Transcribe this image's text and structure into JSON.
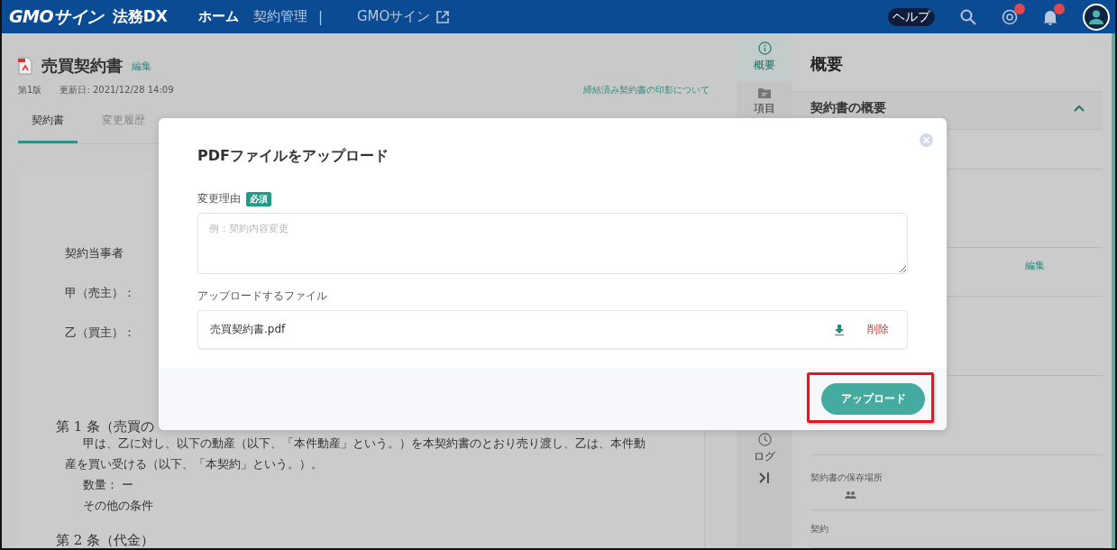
{
  "nav": {
    "logo": "GMOサイン",
    "product": "法務DX",
    "links": [
      {
        "label": "ホーム",
        "selected": true
      },
      {
        "label": "契約管理",
        "selected": false
      }
    ],
    "separator": "|",
    "external": "GMOサイン",
    "help": "ヘルプ",
    "mentions_badge": true,
    "notifications_badge": true
  },
  "document": {
    "title": "売買契約書",
    "edit": "編集",
    "version": "第1版",
    "updated": "更新日: 2021/12/28 14:09",
    "seal_link": "締結済み契約書の印影について",
    "tabs": [
      {
        "label": "契約書",
        "selected": true
      },
      {
        "label": "変更履歴",
        "selected": false
      }
    ],
    "lines": [
      {
        "kind": "party",
        "text": "契約当事者"
      },
      {
        "kind": "party",
        "text": "甲（売主）："
      },
      {
        "kind": "party",
        "text": "乙（買主）："
      },
      {
        "kind": "heading",
        "text": "第 1 条（売買の"
      },
      {
        "kind": "lead",
        "text": "甲は、乙に対し、以下の動産（以下、「本件動産」という。）を本契約書のとおり売り渡し、乙は、本件動"
      },
      {
        "kind": "body",
        "text": "産を買い受ける（以下、「本契約」という。）。"
      },
      {
        "kind": "lead",
        "text": "数量：  ー"
      },
      {
        "kind": "lead",
        "text": "その他の条件"
      },
      {
        "kind": "heading",
        "text": "第 2 条（代金）"
      }
    ]
  },
  "rail": {
    "items": [
      {
        "label": "概要",
        "selected": true
      },
      {
        "label": "項目",
        "selected": false
      },
      {
        "label": "ログ",
        "selected": false
      }
    ]
  },
  "panel": {
    "title": "概要",
    "section": {
      "title": "契約書の概要",
      "expanded": true
    },
    "rows": [
      {
        "kind": "blank"
      },
      {
        "kind": "blank"
      },
      {
        "kind": "action",
        "label": "編集"
      },
      {
        "kind": "blank"
      },
      {
        "kind": "blank"
      },
      {
        "kind": "storage",
        "label": "契約書の保存場所"
      },
      {
        "kind": "field",
        "label": "契約"
      }
    ]
  },
  "modal": {
    "title": "PDFファイルをアップロード",
    "reason": {
      "label": "変更理由",
      "badge": "必須",
      "placeholder": "例：契約内容変更"
    },
    "file": {
      "label": "アップロードするファイル",
      "name": "売買契約書.pdf",
      "delete": "削除"
    },
    "submit": "アップロード",
    "submit_highlighted": true
  }
}
